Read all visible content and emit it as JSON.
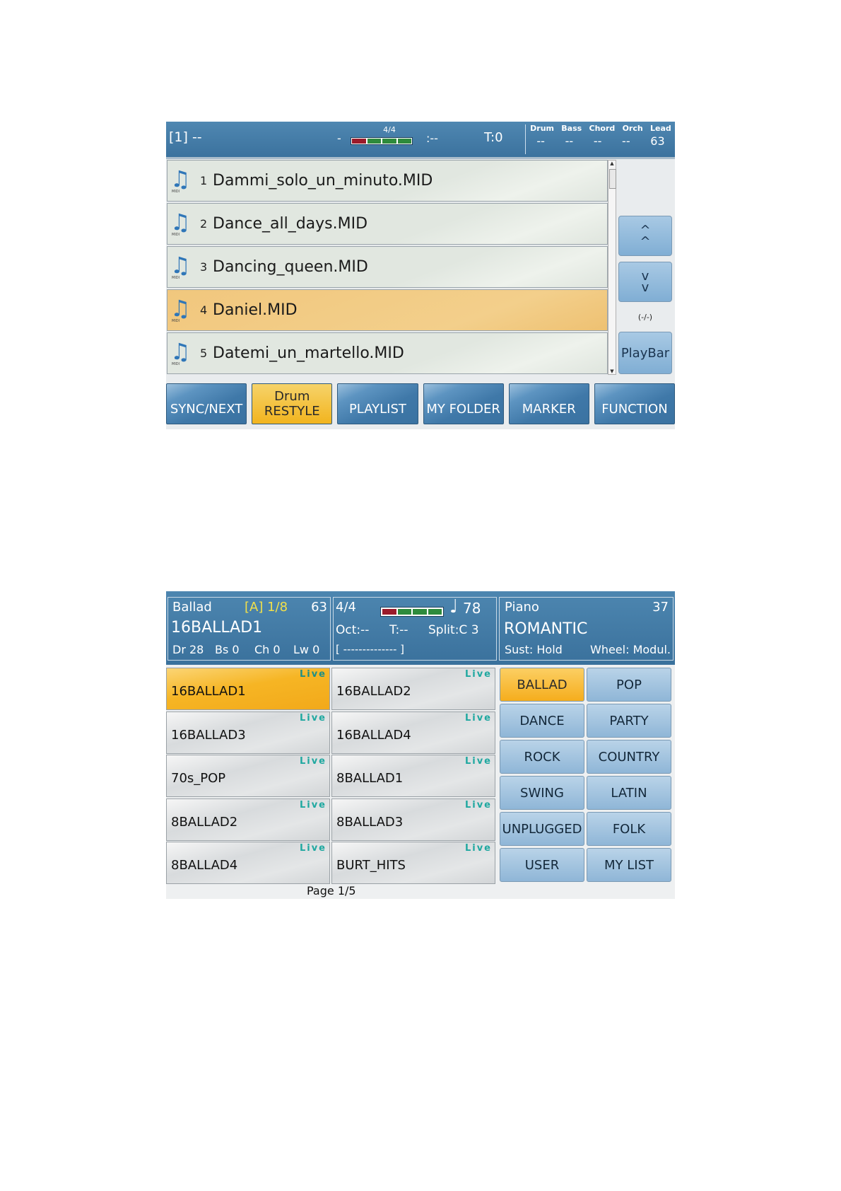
{
  "screen1": {
    "header": {
      "song_slot": "[1] --",
      "dash": "-",
      "time_signature": "4/4",
      "beat_colors": [
        "#9b1b2a",
        "#2e8b3c",
        "#2e8b3c",
        "#2e8b3c"
      ],
      "marker": ":--",
      "transpose": "T:0",
      "parts": [
        {
          "label": "Drum",
          "value": "--"
        },
        {
          "label": "Bass",
          "value": "--"
        },
        {
          "label": "Chord",
          "value": "--"
        },
        {
          "label": "Orch",
          "value": "--"
        },
        {
          "label": "Lead",
          "value": "63"
        }
      ]
    },
    "files": [
      {
        "num": "1",
        "name": "Dammi_solo_un_minuto.MID",
        "icon": "midi-note-icon",
        "selected": false
      },
      {
        "num": "2",
        "name": "Dance_all_days.MID",
        "icon": "midi-note-icon",
        "selected": false
      },
      {
        "num": "3",
        "name": "Dancing_queen.MID",
        "icon": "midi-note-icon",
        "selected": false
      },
      {
        "num": "4",
        "name": "Daniel.MID",
        "icon": "midi-note-icon",
        "selected": true
      },
      {
        "num": "5",
        "name": "Datemi_un_martello.MID",
        "icon": "midi-note-icon",
        "selected": false
      }
    ],
    "midi_tag": "MIDI",
    "side": {
      "page_indicator": "(-/-)",
      "playbar_label": "PlayBar"
    },
    "function_buttons": [
      {
        "label": "SYNC/NEXT",
        "sublabel": "",
        "active": false
      },
      {
        "label": "RESTYLE",
        "sublabel": "Drum",
        "active": true
      },
      {
        "label": "PLAYLIST",
        "sublabel": "",
        "active": false
      },
      {
        "label": "MY FOLDER",
        "sublabel": "",
        "active": false
      },
      {
        "label": "MARKER",
        "sublabel": "",
        "active": false
      },
      {
        "label": "FUNCTION",
        "sublabel": "",
        "active": false
      }
    ]
  },
  "screen2": {
    "style_panel": {
      "category": "Ballad",
      "variation": "[A] 1/8",
      "volume": "63",
      "name": "16BALLAD1",
      "levels": [
        "Dr 28",
        "Bs 0",
        "Ch 0",
        "Lw 0"
      ]
    },
    "tempo_panel": {
      "time_signature": "4/4",
      "beat_colors": [
        "#9b1b2a",
        "#2e8b3c",
        "#2e8b3c",
        "#2e8b3c"
      ],
      "tempo": "78",
      "octave": "Oct:--",
      "transpose": "T:--",
      "split": "Split:C 3",
      "chord_display": "[ -------------- ]"
    },
    "voice_panel": {
      "category": "Piano",
      "volume": "37",
      "name": "ROMANTIC",
      "sustain": "Sust: Hold",
      "wheel": "Wheel: Modul."
    },
    "live_tag": "Live",
    "styles": [
      {
        "name": "16BALLAD1",
        "selected": true
      },
      {
        "name": "16BALLAD2",
        "selected": false
      },
      {
        "name": "16BALLAD3",
        "selected": false
      },
      {
        "name": "16BALLAD4",
        "selected": false
      },
      {
        "name": "70s_POP",
        "selected": false
      },
      {
        "name": "8BALLAD1",
        "selected": false
      },
      {
        "name": "8BALLAD2",
        "selected": false
      },
      {
        "name": "8BALLAD3",
        "selected": false
      },
      {
        "name": "8BALLAD4",
        "selected": false
      },
      {
        "name": "BURT_HITS",
        "selected": false
      }
    ],
    "page_label": "Page 1/5",
    "categories": [
      {
        "label": "BALLAD",
        "selected": true
      },
      {
        "label": "POP",
        "selected": false
      },
      {
        "label": "DANCE",
        "selected": false
      },
      {
        "label": "PARTY",
        "selected": false
      },
      {
        "label": "ROCK",
        "selected": false
      },
      {
        "label": "COUNTRY",
        "selected": false
      },
      {
        "label": "SWING",
        "selected": false
      },
      {
        "label": "LATIN",
        "selected": false
      },
      {
        "label": "UNPLUGGED",
        "selected": false
      },
      {
        "label": "FOLK",
        "selected": false
      },
      {
        "label": "USER",
        "selected": false
      },
      {
        "label": "MY LIST",
        "selected": false
      }
    ]
  }
}
